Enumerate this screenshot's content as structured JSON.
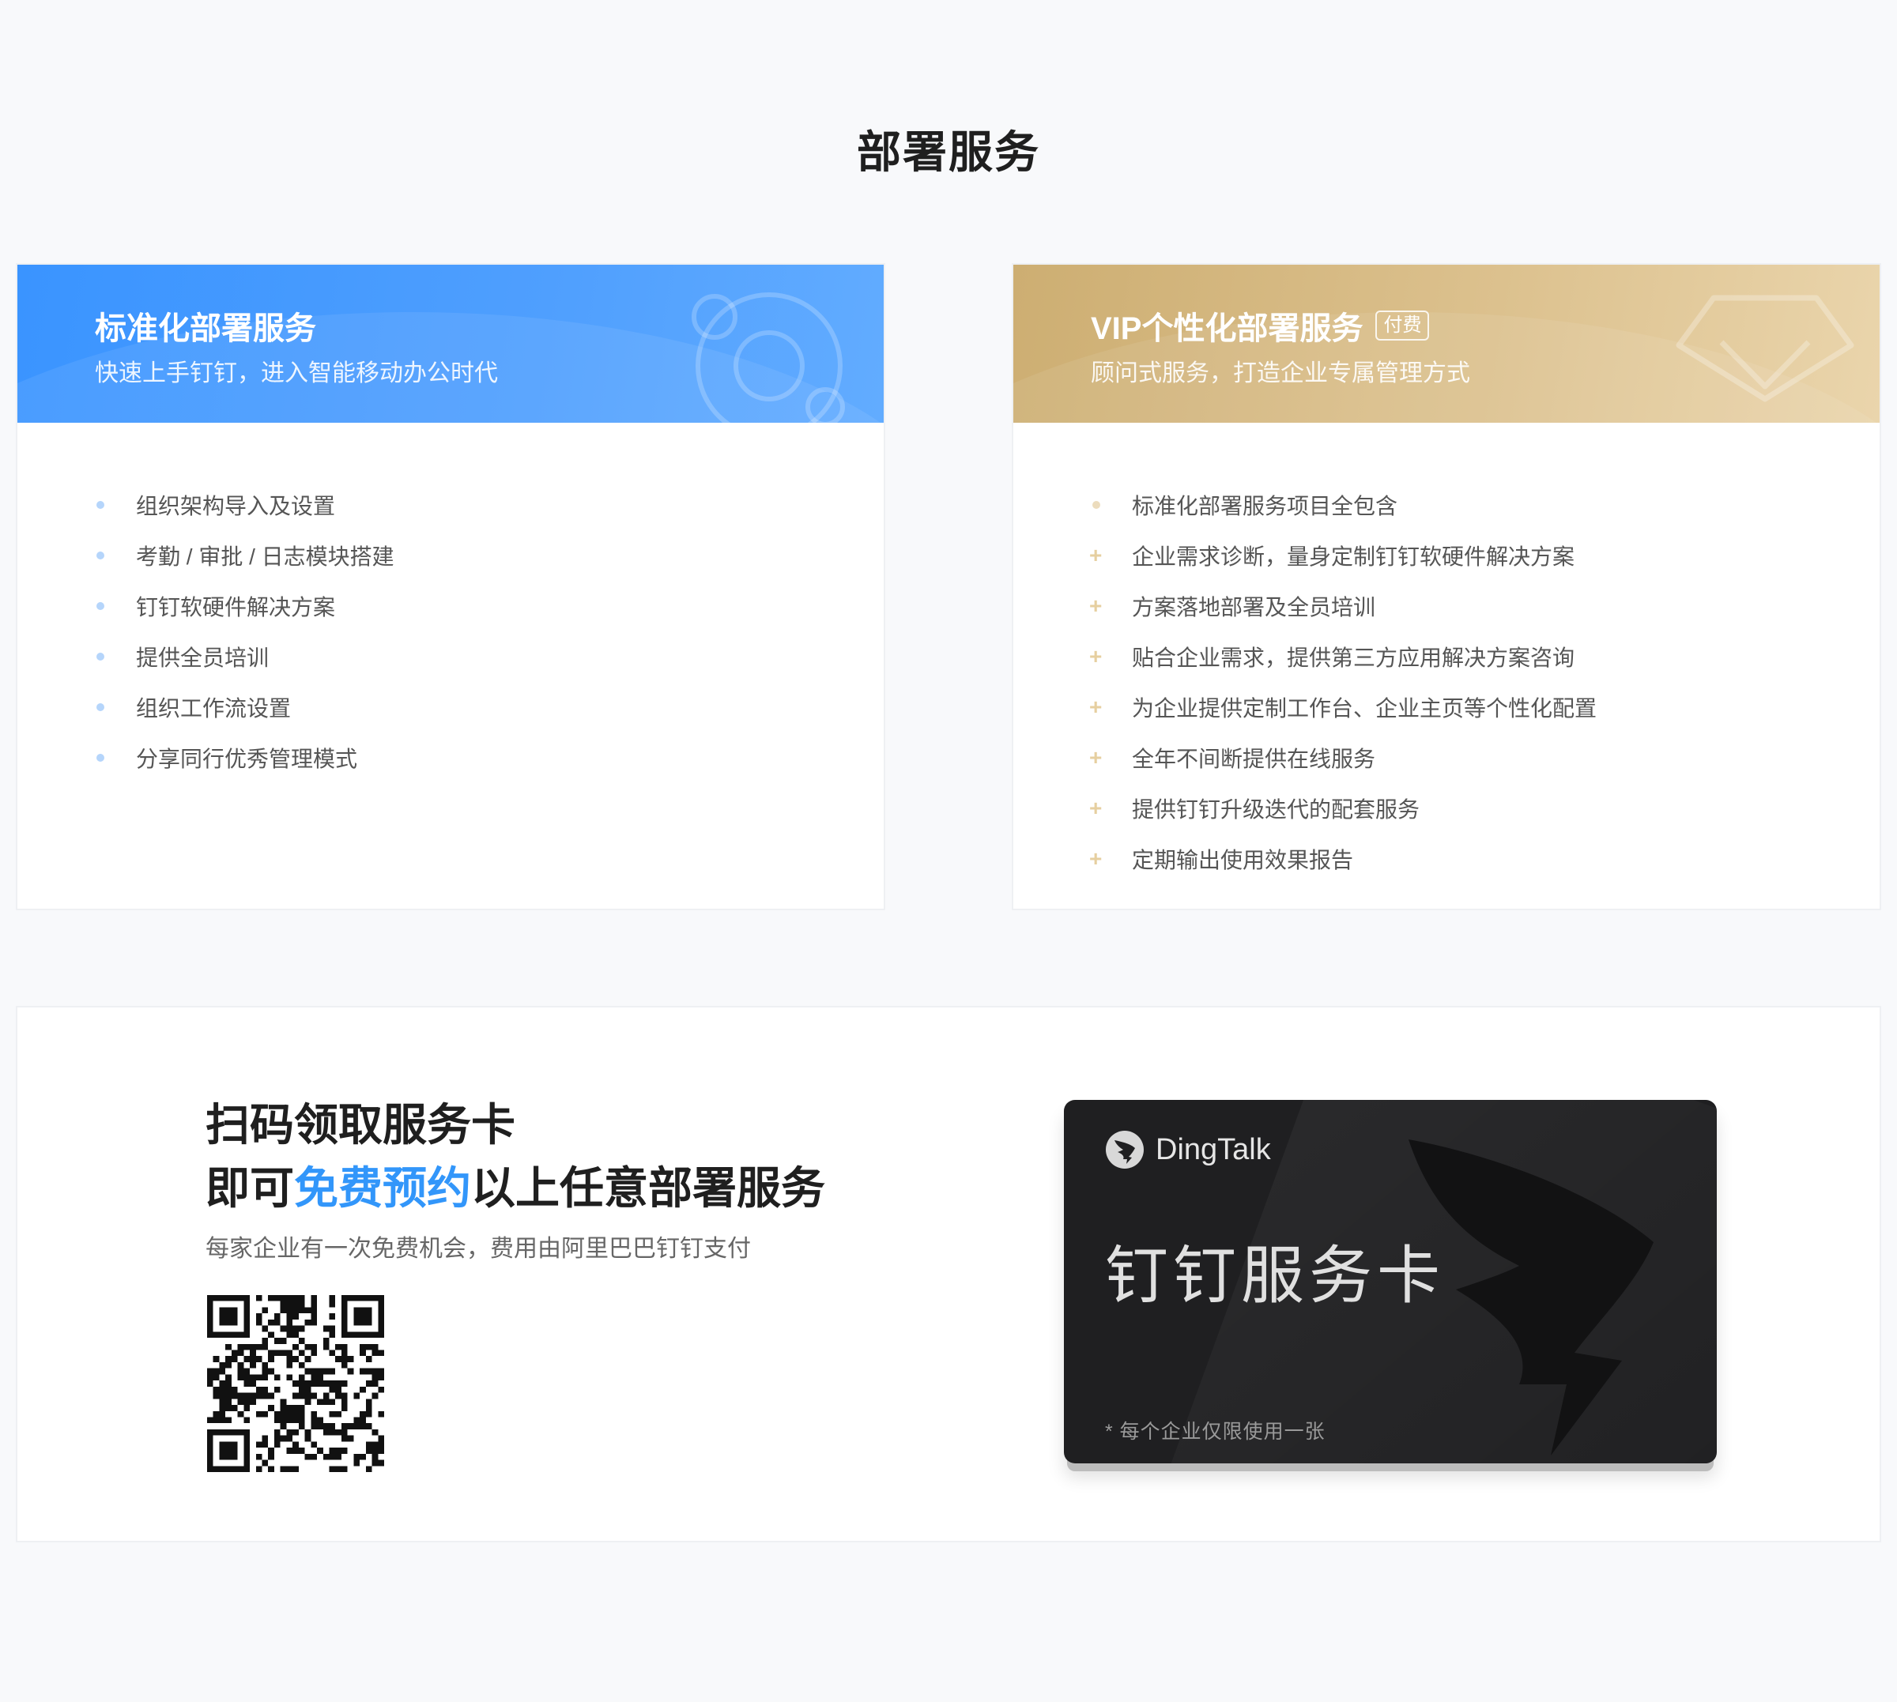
{
  "page": {
    "title": "部署服务"
  },
  "standard": {
    "title": "标准化部署服务",
    "subtitle": "快速上手钉钉，进入智能移动办公时代",
    "items": [
      "组织架构导入及设置",
      "考勤 / 审批 / 日志模块搭建",
      "钉钉软硬件解决方案",
      "提供全员培训",
      "组织工作流设置",
      "分享同行优秀管理模式"
    ]
  },
  "vip": {
    "title": "VIP个性化部署服务",
    "badge": "付费",
    "subtitle": "顾问式服务，打造企业专属管理方式",
    "items": [
      "标准化部署服务项目全包含",
      "企业需求诊断，量身定制钉钉软硬件解决方案",
      "方案落地部署及全员培训",
      "贴合企业需求，提供第三方应用解决方案咨询",
      "为企业提供定制工作台、企业主页等个性化配置",
      "全年不间断提供在线服务",
      "提供钉钉升级迭代的配套服务",
      "定期输出使用效果报告"
    ]
  },
  "promo": {
    "line1": "扫码领取服务卡",
    "line2_prefix": "即可",
    "line2_highlight": "免费预约",
    "line2_suffix": "以上任意部署服务",
    "note": "每家企业有一次免费机会，费用由阿里巴巴钉钉支付"
  },
  "service_card": {
    "brand": "DingTalk",
    "title": "钉钉服务卡",
    "note": "* 每个企业仅限使用一张"
  },
  "colors": {
    "primary_blue": "#3296fa",
    "gold": "#d6b77e",
    "card_dark": "#1f1f21"
  }
}
